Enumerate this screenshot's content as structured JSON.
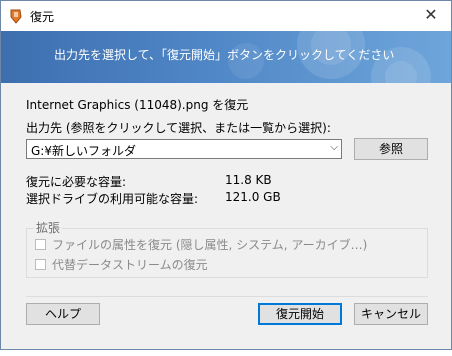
{
  "window": {
    "title": "復元",
    "close_glyph": "✕"
  },
  "banner": {
    "text": "出力先を選択して、「復元開始」ボタンをクリックしてください"
  },
  "info": {
    "file_line": "Internet Graphics (11048).png を復元",
    "output_label": "出力先 (参照をクリックして選択、または一覧から選択):",
    "output_value": "G:¥新しいフォルダ",
    "browse_label": "参照",
    "required_label": "復元に必要な容量:",
    "required_value": "11.8 KB",
    "available_label": "選択ドライブの利用可能な容量:",
    "available_value": "121.0 GB"
  },
  "extended": {
    "title": "拡張",
    "options": [
      {
        "label": "ファイルの属性を復元 (隠し属性, システム, アーカイブ…)",
        "checked": false,
        "enabled": false
      },
      {
        "label": "代替データストリームの復元",
        "checked": false,
        "enabled": false
      }
    ]
  },
  "footer": {
    "help_label": "ヘルプ",
    "start_label": "復元開始",
    "cancel_label": "キャンセル"
  },
  "colors": {
    "banner_start": "#3d6faf",
    "banner_end": "#6ea6db",
    "accent": "#0078d7"
  }
}
